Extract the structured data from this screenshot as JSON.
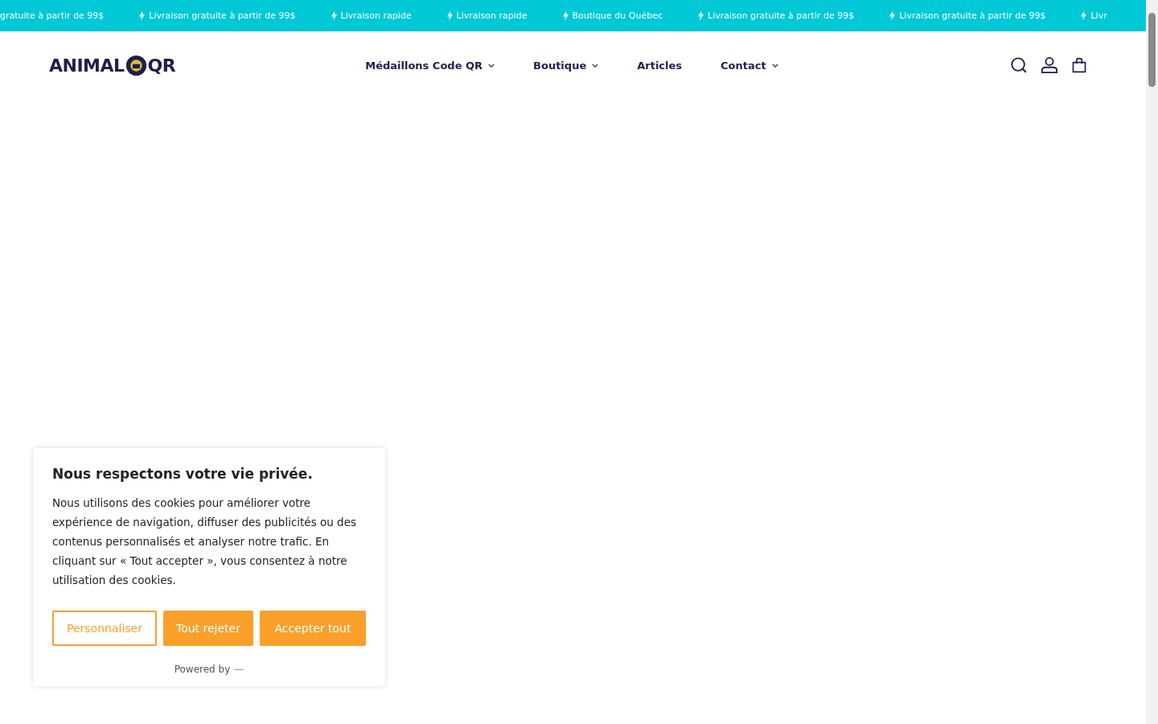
{
  "announcement_bar": {
    "items": [
      {
        "text": "gratuite à partir de 99$",
        "bolt": false
      },
      {
        "text": "Livraison gratuite à partir de 99$",
        "bolt": true
      },
      {
        "text": "Livraison rapide",
        "bolt": true
      },
      {
        "text": "Livraison rapide",
        "bolt": true
      },
      {
        "text": "Boutique du Québec",
        "bolt": true
      },
      {
        "text": "Livraison gratuite à partir de 99$",
        "bolt": true
      },
      {
        "text": "Livraison gratuite à partir de 99$",
        "bolt": true
      },
      {
        "text": "Livr",
        "bolt": true
      }
    ]
  },
  "header": {
    "logo": {
      "left": "ANIMAL",
      "right": "QR"
    },
    "nav": [
      {
        "label": "Médaillons Code QR",
        "dropdown": true
      },
      {
        "label": "Boutique",
        "dropdown": true
      },
      {
        "label": "Articles",
        "dropdown": false
      },
      {
        "label": "Contact",
        "dropdown": true
      }
    ]
  },
  "cookie_banner": {
    "title": "Nous respectons votre vie privée.",
    "body": "Nous utilisons des cookies pour améliorer votre expérience de navigation, diffuser des publicités ou des contenus personnalisés et analyser notre trafic. En cliquant sur « Tout accepter », vous consentez à notre utilisation des cookies.",
    "buttons": [
      {
        "label": "Personnaliser",
        "kind": "outline"
      },
      {
        "label": "Tout rejeter",
        "kind": "filled"
      },
      {
        "label": "Accepter tout",
        "kind": "filled"
      }
    ],
    "footer": "Powered by"
  }
}
